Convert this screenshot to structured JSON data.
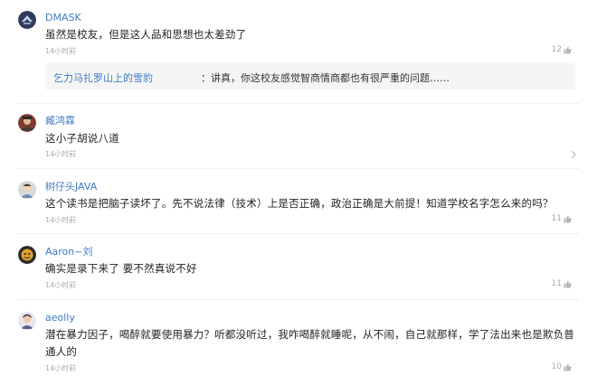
{
  "comments": [
    {
      "user": "DMASK",
      "text": "虽然是校友，但是这人品和思想也太差劲了",
      "time": "14小时前",
      "likes": "12",
      "reply": {
        "user": "乞力马扎罗山上的雪豹",
        "separator": "：",
        "text": "讲真，你这校友感觉智商情商都也有很严重的问题……"
      }
    },
    {
      "user": "臧鸿霖",
      "text": "这小子胡说八道",
      "time": "14小时前",
      "likes": ""
    },
    {
      "user": "树仔头JAVA",
      "text": "这个读书是把脑子读坏了。先不说法律（技术）上是否正确，政治正确是大前提！知道学校名字怎么来的吗？",
      "time": "14小时前",
      "likes": "11"
    },
    {
      "user": "Aaron~刘",
      "text": "确实是录下来了 要不然真说不好",
      "time": "14小时前",
      "likes": "11"
    },
    {
      "user": "aeolly",
      "text": "潜在暴力因子，喝醉就要使用暴力？听都没听过，我咋喝醉就睡呢，从不闹，自己就那样，学了法出来也是欺负普通人的",
      "time": "14小时前",
      "likes": "10"
    }
  ]
}
